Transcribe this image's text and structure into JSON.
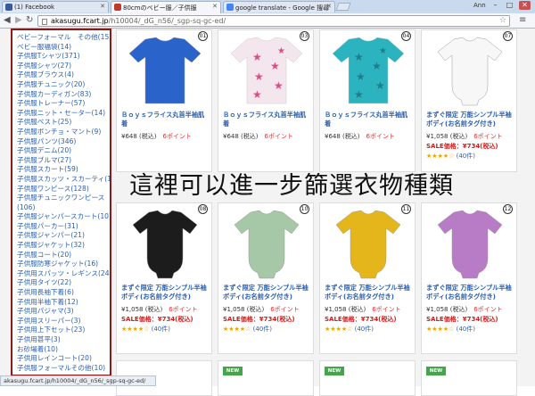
{
  "browser": {
    "tabs": [
      {
        "label": "(1) Facebook",
        "favicon_color": "#3b5998"
      },
      {
        "label": "80cmのベビー服／子供服",
        "favicon_color": "#c0392b"
      },
      {
        "label": "google translate - Google 搜尋",
        "favicon_color": "#4285f4"
      }
    ],
    "user": "Ann",
    "minimize": "–",
    "maximize": "□",
    "close": "✕",
    "url_host": "akasugu.fcart.jp",
    "url_path": "/h10004/_dG_n56/_sgp-sq-gc-ed/"
  },
  "sidebar": {
    "categories": [
      "ベビーフォーマル　その他(15)",
      "ベビー服福袋(14)",
      "子供服Tシャツ(371)",
      "子供服シャツ(27)",
      "子供服ブラウス(4)",
      "子供服チュニック(20)",
      "子供服カーディガン(83)",
      "子供服トレーナー(57)",
      "子供服ニット・セーター(14)",
      "子供服ベスト(25)",
      "子供服ボンチョ・マント(9)",
      "子供服パンツ(346)",
      "子供服デニム(20)",
      "子供服ブルマ(27)",
      "子供服スカート(59)",
      "子供服スカッツ・スカーティ(10)",
      "子供服ワンピース(128)",
      "子供服チュニックワンピース",
      "(106)",
      "子供服ジャンパースカート(10)",
      "子供服パーカー(31)",
      "子供服ジャンパー(21)",
      "子供服ジャケット(32)",
      "子供服コート(20)",
      "子供服防寒ジャケット(16)",
      "子供用スパッツ・レギンス(24)",
      "子供用タイツ(22)",
      "子供用長袖下着(6)",
      "子供用半袖下着(12)",
      "子供用パジャマ(3)",
      "子供用スリーパー(3)",
      "子供用上下セット(23)",
      "子供用甚平(3)",
      "お砂場着(10)",
      "子供用レインコート(20)",
      "子供服フォーマルその他(10)"
    ]
  },
  "status_url": "akasugu.fcart.jp/h10004/_dG_n56/_sgp-sq-gc-ed/",
  "annotation": "這裡可以進一步篩選衣物種類",
  "products_row1": [
    {
      "rank": "01",
      "name": "Ｂｏｙｓフライス丸首半袖肌着",
      "price": "¥648 (税込)",
      "points": "6ポイント",
      "garment_color": "#2a63c9"
    },
    {
      "rank": "03",
      "name": "Ｂｏｙｓフライス丸首半袖肌着",
      "price": "¥648 (税込)",
      "points": "6ポイント",
      "garment_color": "#f3e6ec"
    },
    {
      "rank": "04",
      "name": "Ｂｏｙｓフライス丸首半袖肌着",
      "price": "¥648 (税込)",
      "points": "6ポイント",
      "garment_color": "#2bb3c0"
    },
    {
      "rank": "07",
      "name": "まずぐ限定 万能シンプル半袖ボディ(お名前タグ付き)",
      "price": "¥1,058 (税込)",
      "points": "6ポイント",
      "sale": "SALE価格：¥734(税込)",
      "stars": "★★★★☆",
      "count": "(40件)",
      "garment_color": "#f7f7f7"
    }
  ],
  "products_row2": [
    {
      "rank": "08",
      "name": "まずぐ限定 万能シンプル半袖ボディ(お名前タグ付き)",
      "price": "¥1,058 (税込)",
      "points": "6ポイント",
      "sale": "SALE価格：¥734(税込)",
      "stars": "★★★★☆",
      "count": "(40件)",
      "garment_color": "#1c1c1c"
    },
    {
      "rank": "10",
      "name": "まずぐ限定 万能シンプル半袖ボディ(お名前タグ付き)",
      "price": "¥1,058 (税込)",
      "points": "6ポイント",
      "sale": "SALE価格：¥734(税込)",
      "stars": "★★★★☆",
      "count": "(40件)",
      "garment_color": "#a6c8a6"
    },
    {
      "rank": "11",
      "name": "まずぐ限定 万能シンプル半袖ボディ(お名前タグ付き)",
      "price": "¥1,058 (税込)",
      "points": "6ポイント",
      "sale": "SALE価格：¥734(税込)",
      "stars": "★★★★☆",
      "count": "(40件)",
      "garment_color": "#e5b61c"
    },
    {
      "rank": "12",
      "name": "まずぐ限定 万能シンプル半袖ボディ(お名前タグ付き)",
      "price": "¥1,058 (税込)",
      "points": "6ポイント",
      "sale": "SALE価格：¥734(税込)",
      "stars": "★★★★☆",
      "count": "(40件)",
      "garment_color": "#b87bc6"
    }
  ],
  "new_badge": "NEW"
}
